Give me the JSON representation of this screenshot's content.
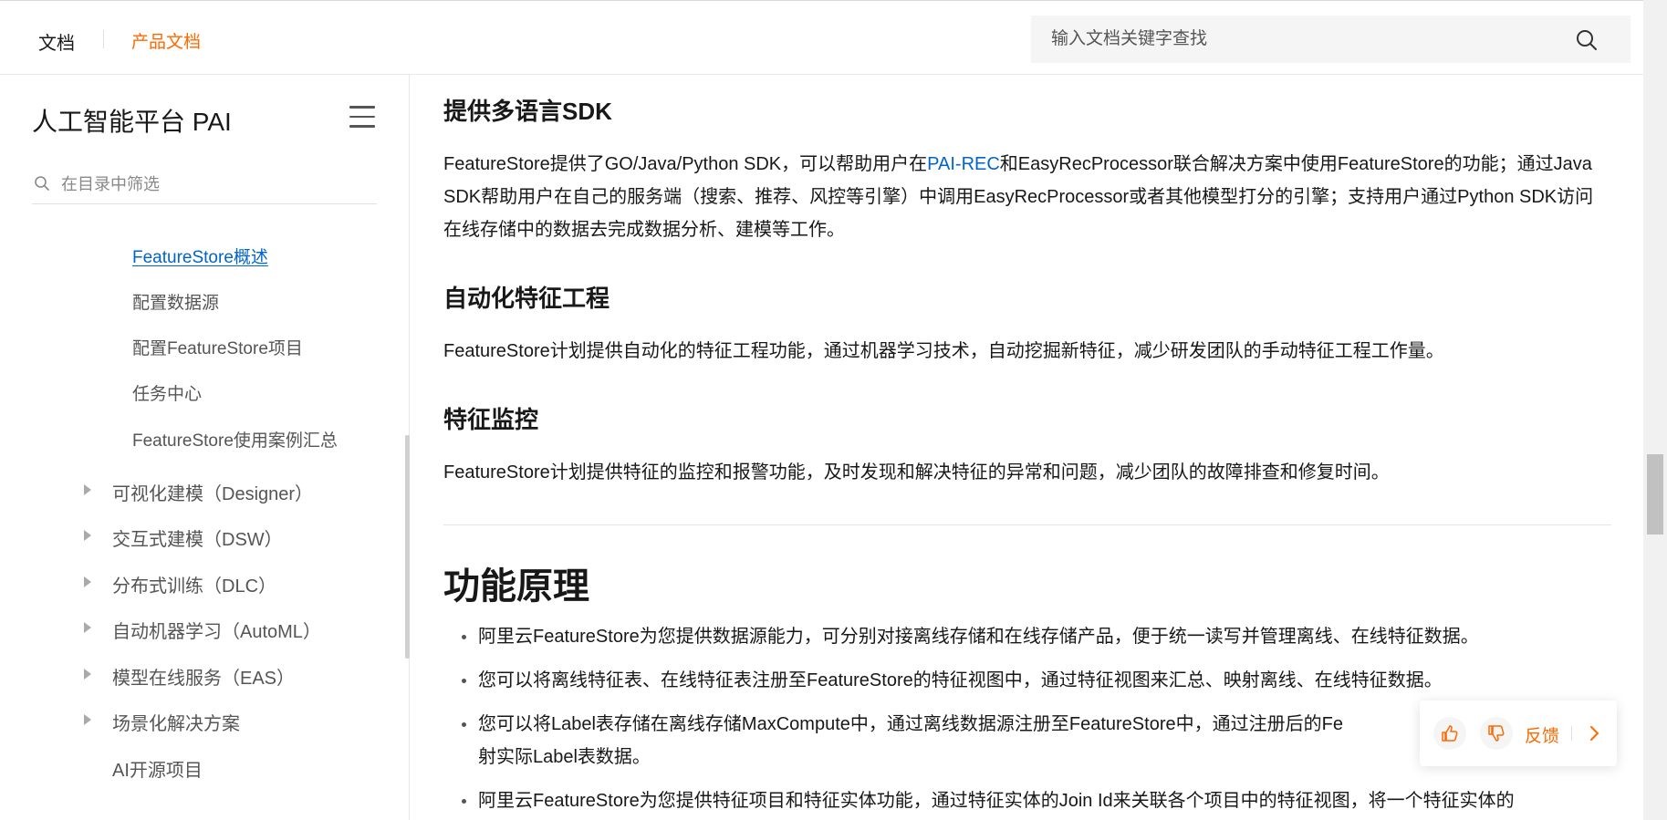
{
  "header": {
    "brand": "文档",
    "sub_brand": "产品文档",
    "search_placeholder": "输入文档关键字查找"
  },
  "sidebar": {
    "title": "人工智能平台 PAI",
    "filter_placeholder": "在目录中筛选",
    "sub_items": [
      {
        "label": "FeatureStore概述",
        "active": true
      },
      {
        "label": "配置数据源"
      },
      {
        "label": "配置FeatureStore项目"
      },
      {
        "label": "任务中心"
      },
      {
        "label": "FeatureStore使用案例汇总"
      }
    ],
    "groups": [
      {
        "label": "可视化建模（Designer）"
      },
      {
        "label": "交互式建模（DSW）"
      },
      {
        "label": "分布式训练（DLC）"
      },
      {
        "label": "自动机器学习（AutoML）"
      },
      {
        "label": "模型在线服务（EAS）"
      },
      {
        "label": "场景化解决方案"
      }
    ],
    "plain_items": [
      {
        "label": "AI开源项目"
      }
    ]
  },
  "content": {
    "section1": {
      "heading": "提供多语言SDK",
      "text_before_link": "FeatureStore提供了GO/Java/Python SDK，可以帮助用户在",
      "link": "PAI-REC",
      "text_after_link": "和EasyRecProcessor联合解决方案中使用FeatureStore的功能；通过Java SDK帮助用户在自己的服务端（搜索、推荐、风控等引擎）中调用EasyRecProcessor或者其他模型打分的引擎；支持用户通过Python SDK访问在线存储中的数据去完成数据分析、建模等工作。"
    },
    "section2": {
      "heading": "自动化特征工程",
      "text": "FeatureStore计划提供自动化的特征工程功能，通过机器学习技术，自动挖掘新特征，减少研发团队的手动特征工程工作量。"
    },
    "section3": {
      "heading": "特征监控",
      "text": "FeatureStore计划提供特征的监控和报警功能，及时发现和解决特征的异常和问题，减少团队的故障排查和修复时间。"
    },
    "principles": {
      "heading": "功能原理",
      "bullets": [
        "阿里云FeatureStore为您提供数据源能力，可分别对接离线存储和在线存储产品，便于统一读写并管理离线、在线特征数据。",
        "您可以将离线特征表、在线特征表注册至FeatureStore的特征视图中，通过特征视图来汇总、映射离线、在线特征数据。",
        "您可以将Label表存储在离线存储MaxCompute中，通过离线数据源注册至FeatureStore中，通过注册后的Fe",
        "射实际Label表数据。",
        "阿里云FeatureStore为您提供特征项目和特征实体功能，通过特征实体的Join Id来关联各个项目中的特征视图，将一个特征实体的"
      ]
    }
  },
  "feedback": {
    "label": "反馈",
    "accent": "#ff6a00"
  },
  "colors": {
    "link": "#0064c8",
    "brand_orange": "#ff6a00",
    "text": "#181818"
  }
}
